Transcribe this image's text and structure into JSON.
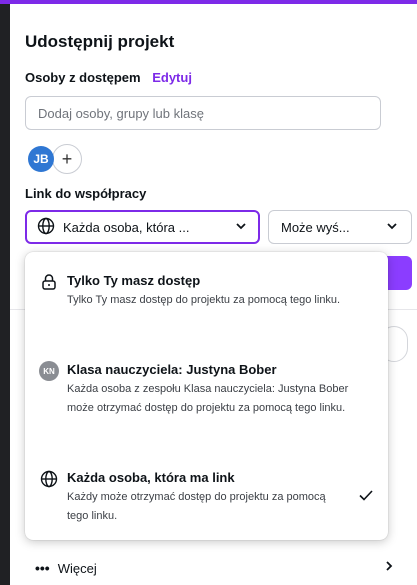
{
  "panel": {
    "title": "Udostępnij projekt",
    "people_label": "Osoby z dostępem",
    "edit_label": "Edytuj",
    "search_placeholder": "Dodaj osoby, grupy lub klasę",
    "avatar_initials": "JB",
    "add_person_symbol": "+",
    "link_section_label": "Link do współpracy",
    "access_select_value": "Każda osoba, która ...",
    "permission_select_value": "Może wyś...",
    "more_label": "Więcej",
    "accent_color": "#7d2ae8"
  },
  "dropdown": {
    "options": [
      {
        "icon": "lock-icon",
        "title": "Tylko Ty masz dostęp",
        "description": "Tylko Ty masz dostęp do projektu za pomocą tego linku."
      },
      {
        "icon": "kn-badge",
        "badge_text": "KN",
        "title": "Klasa nauczyciela: Justyna Bober",
        "description": "Każda osoba z zespołu Klasa nauczyciela: Justyna Bober może otrzymać dostęp do projektu za pomocą tego linku."
      },
      {
        "icon": "globe-icon",
        "title": "Każda osoba, która ma link",
        "description": "Każdy może otrzymać dostęp do projektu za pomocą tego linku.",
        "selected": true
      }
    ]
  }
}
